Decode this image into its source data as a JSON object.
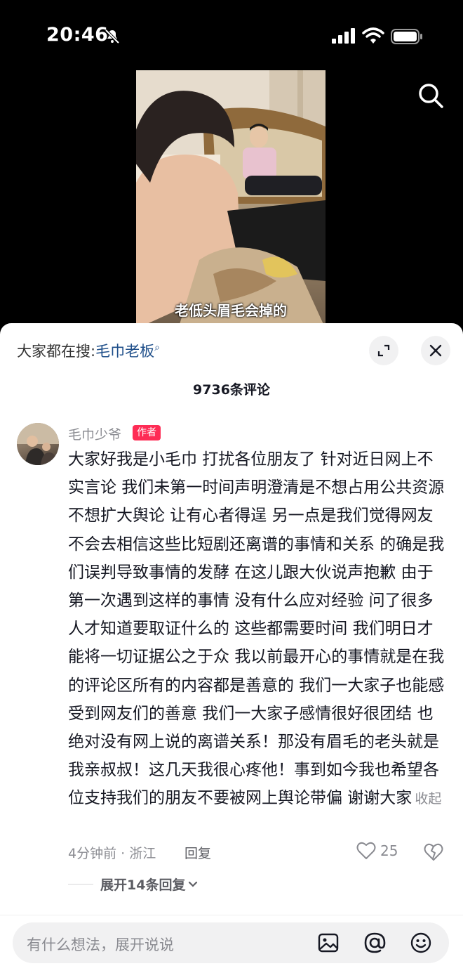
{
  "status_bar": {
    "time": "20:46"
  },
  "video": {
    "caption": "老低头眉毛会掉的"
  },
  "sheet": {
    "hot_search_prefix": "大家都在搜:",
    "hot_search_term": "毛巾老板",
    "comment_count_label": "9736条评论"
  },
  "comment": {
    "username": "毛巾少爷",
    "badge": "作者",
    "text": "大家好我是小毛巾 打扰各位朋友了 针对近日网上不实言论 我们未第一时间声明澄清是不想占用公共资源 不想扩大舆论 让有心者得逞 另一点是我们觉得网友不会去相信这些比短剧还离谱的事情和关系 的确是我们误判导致事情的发酵 在这儿跟大伙说声抱歉  由于第一次遇到这样的事情 没有什么应对经验 问了很多人才知道要取证什么的 这些都需要时间 我们明日才能将一切证据公之于众 我以前最开心的事情就是在我的评论区所有的内容都是善意的 我们一大家子也能感受到网友们的善意 我们一大家子感情很好很团结 也绝对没有网上说的离谱关系！那没有眉毛的老头就是我亲叔叔！这几天我很心疼他！事到如今我也希望各位支持我们的朋友不要被网上舆论带偏 谢谢大家",
    "collapse_label": "收起",
    "meta": "4分钟前 · 浙江",
    "reply_label": "回复",
    "like_count": "25",
    "expand_replies_label": "展开14条回复"
  },
  "input": {
    "placeholder": "有什么想法，展开说说"
  },
  "icons": [
    "mute-icon",
    "signal-icon",
    "wifi-icon",
    "battery-icon",
    "search-icon",
    "expand-icon",
    "close-icon",
    "heart-icon",
    "dislike-icon",
    "chevron-down-icon",
    "image-icon",
    "at-icon",
    "emoji-icon"
  ],
  "colors": {
    "accent_red": "#fe2c55",
    "link_blue": "#1f4f8a",
    "muted_gray": "#8a8b91"
  }
}
